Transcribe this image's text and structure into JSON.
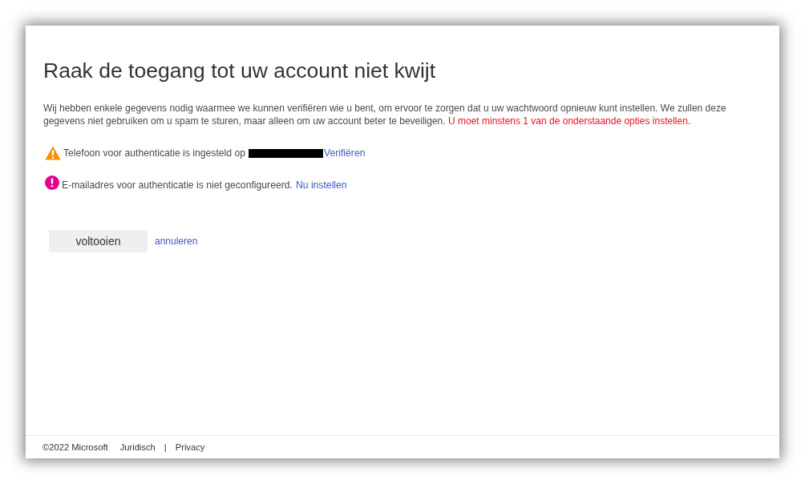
{
  "page": {
    "title": "Raak de toegang tot uw account niet kwijt",
    "intro": "Wij hebben enkele gegevens nodig waarmee we kunnen verifiëren wie u bent, om ervoor te zorgen dat u uw wachtwoord opnieuw kunt instellen. We zullen deze gegevens niet gebruiken om u spam te sturen, maar alleen om uw account beter te beveiligen.",
    "requirement": "U moet minstens 1 van de onderstaande opties instellen."
  },
  "methods": [
    {
      "kind": "warning",
      "text": "Telefoon voor authenticatie is ingesteld op",
      "redacted": true,
      "link": "Verifiëren"
    },
    {
      "kind": "error",
      "text": "E-mailadres voor authenticatie is niet geconfigureerd.",
      "redacted": false,
      "link": "Nu instellen"
    }
  ],
  "actions": {
    "submit": "voltooien",
    "cancel": "annuleren"
  },
  "footer": {
    "copyright": "©2022 Microsoft",
    "links": [
      "Juridisch",
      "Privacy"
    ],
    "separator": "|"
  }
}
